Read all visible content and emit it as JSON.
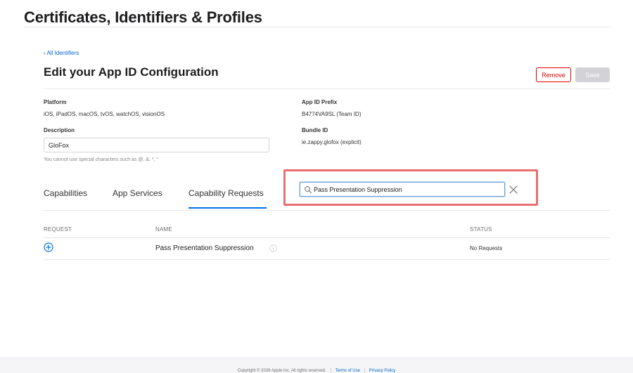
{
  "header": {
    "site_title": "Certificates, Identifiers & Profiles"
  },
  "nav": {
    "back_link": "‹ All Identifiers"
  },
  "page": {
    "heading": "Edit your App ID Configuration",
    "remove_label": "Remove",
    "save_label": "Save"
  },
  "details": {
    "platform_label": "Platform",
    "platform_value": "iOS, iPadOS, macOS, tvOS, watchOS, visionOS",
    "prefix_label": "App ID Prefix",
    "prefix_value": "B4774VA9SL (Team ID)",
    "description_label": "Description",
    "description_value": "GloFox",
    "description_hint": "You cannot use special characters such as @, &, *, \"",
    "bundle_label": "Bundle ID",
    "bundle_value": "ie.zappy.glofox (explicit)"
  },
  "tabs": [
    {
      "label": "Capabilities"
    },
    {
      "label": "App Services"
    },
    {
      "label": "Capability Requests"
    }
  ],
  "search": {
    "value": "Pass Presentation Suppression"
  },
  "table": {
    "headers": {
      "request": "REQUEST",
      "name": "NAME",
      "status": "STATUS"
    },
    "rows": [
      {
        "name": "Pass Presentation Suppression",
        "status": "No Requests"
      }
    ]
  },
  "footer": {
    "copyright": "Copyright © 2026 Apple Inc. All rights reserved.",
    "terms": "Terms of Use",
    "privacy": "Privacy Policy"
  },
  "colors": {
    "accent": "#0071e3",
    "link": "#0066cc",
    "remove": "#e30000",
    "highlight": "#e87070"
  }
}
